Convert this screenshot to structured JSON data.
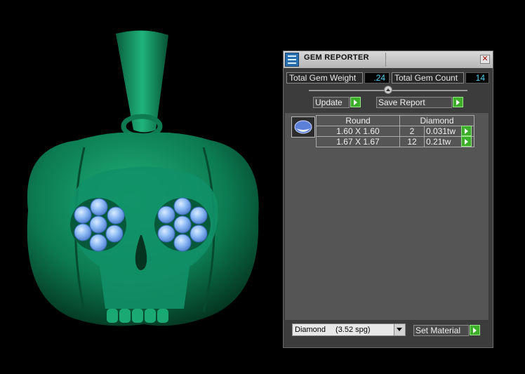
{
  "window": {
    "title": "GEM REPORTER",
    "close_symbol": "✕",
    "icon": "gem-reporter-app-icon"
  },
  "summary": {
    "weight_label": "Total Gem Weight",
    "weight_value": ".24",
    "count_label": "Total Gem Count",
    "count_value": "14"
  },
  "slider": {
    "level": 0.5
  },
  "actions": {
    "update_label": "Update",
    "save_report_label": "Save Report"
  },
  "gem_table": {
    "shape_header": "Round",
    "material_header": "Diamond",
    "rows": [
      {
        "size": "1.60 X 1.60",
        "count": "2",
        "weight": "0.031tw"
      },
      {
        "size": "1.67 X 1.67",
        "count": "12",
        "weight": "0.21tw"
      }
    ]
  },
  "material": {
    "selected_name": "Diamond",
    "selected_spg": "(3.52 spg)",
    "set_material_label": "Set Material"
  },
  "colors": {
    "model": "#0f8a5e",
    "gems": "#7fb0f0",
    "value_text": "#4ed0f0",
    "go_button": "#3cae2a"
  }
}
